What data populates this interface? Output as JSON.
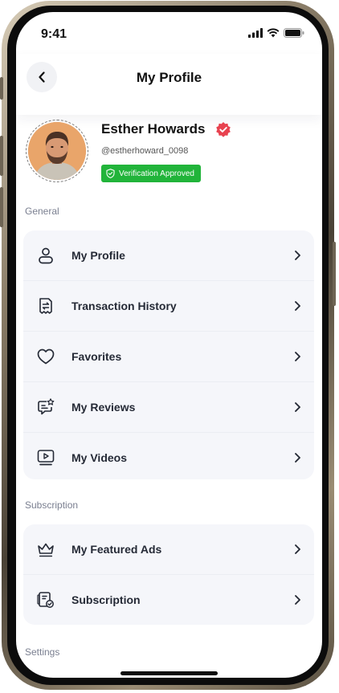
{
  "status_bar": {
    "time": "9:41"
  },
  "header": {
    "title": "My Profile"
  },
  "profile": {
    "name": "Esther Howards",
    "handle": "@estherhoward_0098",
    "badge": "Verification Approved"
  },
  "sections": [
    {
      "label": "General",
      "items": [
        {
          "label": "My Profile",
          "icon": "user-icon"
        },
        {
          "label": "Transaction History",
          "icon": "receipt-icon"
        },
        {
          "label": "Favorites",
          "icon": "heart-icon"
        },
        {
          "label": "My Reviews",
          "icon": "review-icon"
        },
        {
          "label": "My Videos",
          "icon": "video-icon"
        }
      ]
    },
    {
      "label": "Subscription",
      "items": [
        {
          "label": "My Featured Ads",
          "icon": "crown-icon"
        },
        {
          "label": "Subscription",
          "icon": "subscription-icon"
        }
      ]
    },
    {
      "label": "Settings",
      "items": []
    }
  ],
  "colors": {
    "accent_green": "#21b43a",
    "verified_red": "#e8424f",
    "card_bg": "#f5f6fa"
  }
}
